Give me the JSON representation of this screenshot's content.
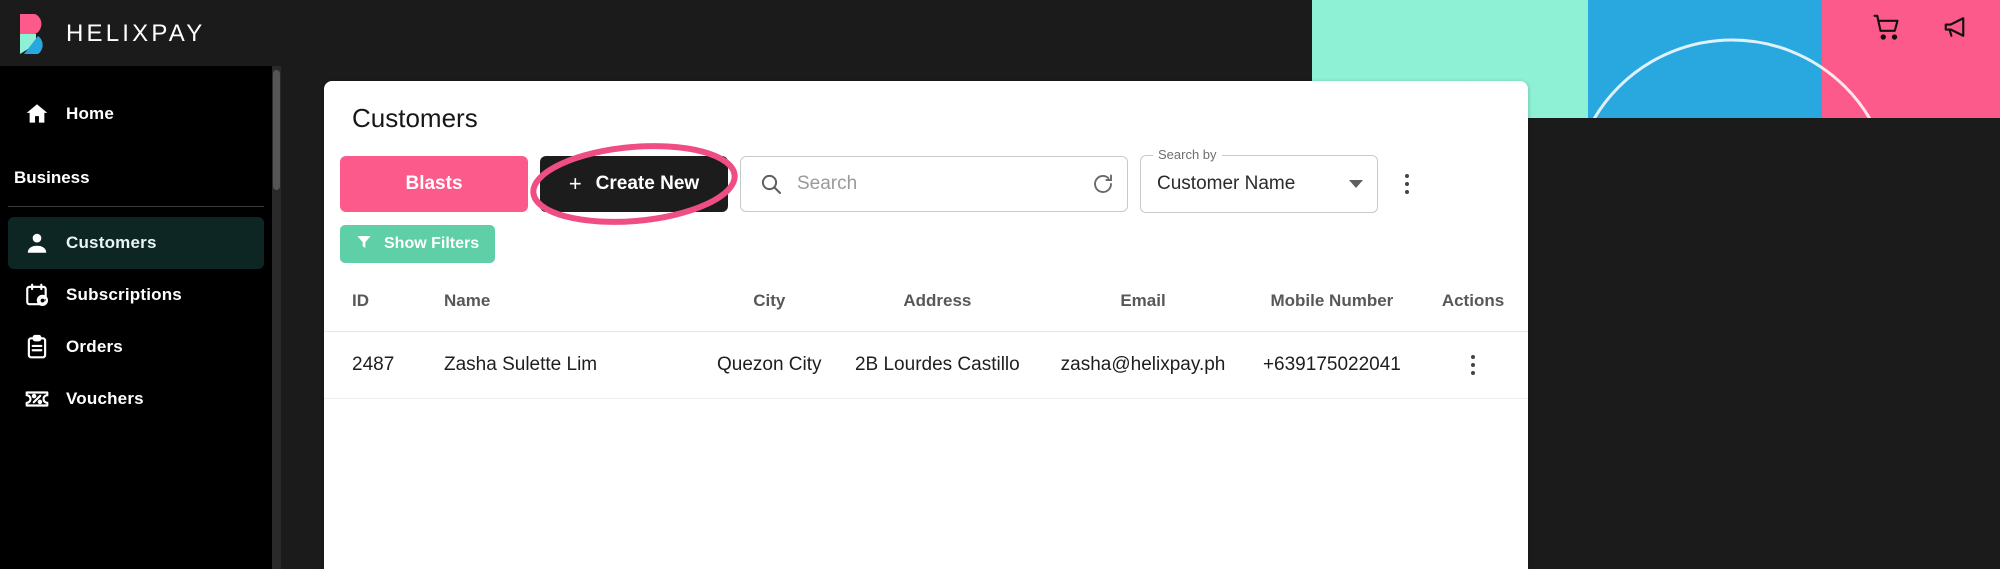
{
  "brand": {
    "name": "HELIXPAY",
    "logo_icon": "helixpay-logo-mark",
    "colors": {
      "pink": "#fb5a8a",
      "mint": "#8ef0d4",
      "blue": "#29a8e0",
      "dark": "#1c1c1c",
      "green": "#5ecfa7"
    }
  },
  "topbar": {
    "cart_icon": "shopping-cart-icon",
    "announcement_icon": "megaphone-icon"
  },
  "sidebar": {
    "home": {
      "label": "Home",
      "icon": "home-icon"
    },
    "section_title": "Business",
    "items": [
      {
        "label": "Customers",
        "icon": "person-icon",
        "active": true
      },
      {
        "label": "Subscriptions",
        "icon": "calendar-refresh-icon",
        "active": false
      },
      {
        "label": "Orders",
        "icon": "clipboard-icon",
        "active": false
      },
      {
        "label": "Vouchers",
        "icon": "ticket-percent-icon",
        "active": false
      }
    ]
  },
  "main": {
    "title": "Customers",
    "buttons": {
      "blasts": "Blasts",
      "create_new": "Create New",
      "create_new_icon": "plus-icon",
      "show_filters": "Show Filters",
      "filter_icon": "funnel-icon"
    },
    "search": {
      "placeholder": "Search",
      "value": "",
      "search_icon": "search-icon",
      "refresh_icon": "refresh-icon"
    },
    "search_by": {
      "legend": "Search by",
      "value": "Customer Name",
      "caret_icon": "chevron-down-icon"
    },
    "more_options_icon": "kebab-menu-icon",
    "table": {
      "columns": [
        "ID",
        "Name",
        "City",
        "Address",
        "Email",
        "Mobile Number",
        "Actions"
      ],
      "rows": [
        {
          "id": "2487",
          "name": "Zasha Sulette Lim",
          "city": "Quezon City",
          "address": "2B Lourdes Castillo",
          "email": "zasha@helixpay.ph",
          "mobile": "+639175022041",
          "actions_icon": "kebab-menu-icon"
        }
      ]
    }
  },
  "annotation": {
    "type": "hand-drawn-ellipse-highlight",
    "target": "create-new-button",
    "color": "#ef4e85"
  }
}
